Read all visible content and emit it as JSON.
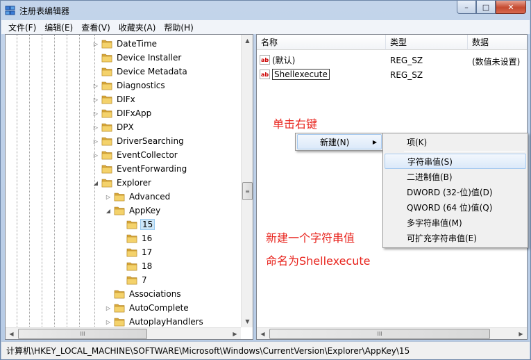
{
  "window": {
    "title": "注册表编辑器",
    "min": "–",
    "max": "□",
    "close": "✕"
  },
  "menu": [
    "文件(F)",
    "编辑(E)",
    "查看(V)",
    "收藏夹(A)",
    "帮助(H)"
  ],
  "tree": [
    {
      "label": "DateTime",
      "level": 0,
      "expander": "▷"
    },
    {
      "label": "Device Installer",
      "level": 0,
      "expander": ""
    },
    {
      "label": "Device Metadata",
      "level": 0,
      "expander": ""
    },
    {
      "label": "Diagnostics",
      "level": 0,
      "expander": "▷"
    },
    {
      "label": "DIFx",
      "level": 0,
      "expander": "▷"
    },
    {
      "label": "DIFxApp",
      "level": 0,
      "expander": "▷"
    },
    {
      "label": "DPX",
      "level": 0,
      "expander": "▷"
    },
    {
      "label": "DriverSearching",
      "level": 0,
      "expander": "▷"
    },
    {
      "label": "EventCollector",
      "level": 0,
      "expander": "▷"
    },
    {
      "label": "EventForwarding",
      "level": 0,
      "expander": ""
    },
    {
      "label": "Explorer",
      "level": 0,
      "expander": "◢"
    },
    {
      "label": "Advanced",
      "level": 1,
      "expander": "▷"
    },
    {
      "label": "AppKey",
      "level": 1,
      "expander": "◢"
    },
    {
      "label": "15",
      "level": 2,
      "expander": "",
      "selected": true
    },
    {
      "label": "16",
      "level": 2,
      "expander": ""
    },
    {
      "label": "17",
      "level": 2,
      "expander": ""
    },
    {
      "label": "18",
      "level": 2,
      "expander": ""
    },
    {
      "label": "7",
      "level": 2,
      "expander": ""
    },
    {
      "label": "Associations",
      "level": 1,
      "expander": ""
    },
    {
      "label": "AutoComplete",
      "level": 1,
      "expander": "▷"
    },
    {
      "label": "AutoplayHandlers",
      "level": 1,
      "expander": "▷"
    }
  ],
  "columns": [
    "名称",
    "类型",
    "数据"
  ],
  "values": [
    {
      "name": "(默认)",
      "type": "REG_SZ",
      "data": "(数值未设置)"
    },
    {
      "name": "Shellexecute",
      "type": "REG_SZ",
      "data": ""
    }
  ],
  "annotations": {
    "right_click": "单击右键",
    "new_string": "新建一个字符串值",
    "rename": "命名为Shellexecute"
  },
  "context_menu": {
    "new_label": "新建(N)",
    "arrow": "▶"
  },
  "submenu": [
    "项(K)",
    "字符串值(S)",
    "二进制值(B)",
    "DWORD (32-位)值(D)",
    "QWORD (64 位)值(Q)",
    "多字符串值(M)",
    "可扩充字符串值(E)"
  ],
  "icons": {
    "ab": "ab",
    "up": "▲",
    "down": "▼",
    "left": "◀",
    "right": "▶",
    "grip": "≡",
    "grip_h": "III"
  },
  "status": "计算机\\HKEY_LOCAL_MACHINE\\SOFTWARE\\Microsoft\\Windows\\CurrentVersion\\Explorer\\AppKey\\15"
}
